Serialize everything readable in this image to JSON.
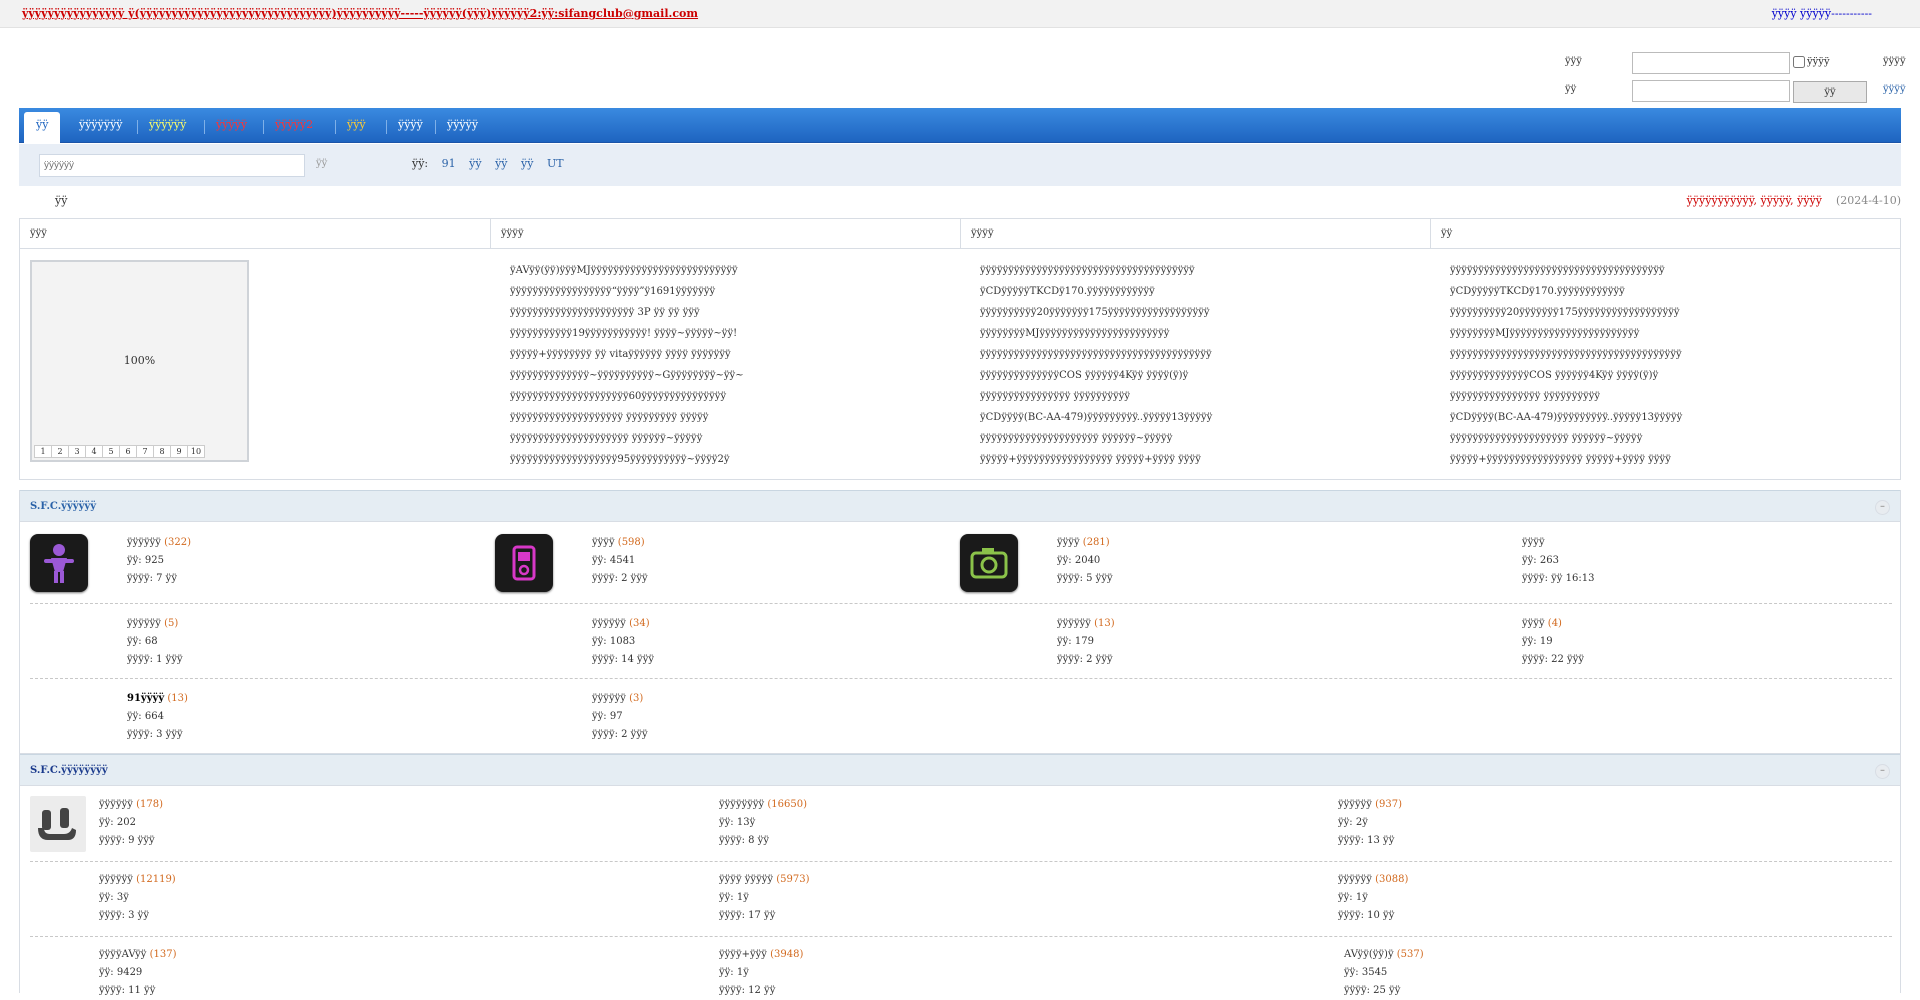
{
  "topbar": {
    "notice": "ÿÿÿÿÿÿÿÿÿÿÿÿÿÿÿÿ ÿ(ÿÿÿÿÿÿÿÿÿÿÿÿÿÿÿÿÿÿÿÿÿÿÿÿÿÿÿÿÿÿ)ÿÿÿÿÿÿÿÿÿÿ-----ÿÿÿÿÿÿ(ÿÿÿ)ÿÿÿÿÿÿ2:ÿÿ:sifangclub@gmail.com",
    "right_links": "ÿÿÿÿ ÿÿÿÿÿ-----------"
  },
  "login": {
    "user_label": "ÿÿÿ",
    "pass_label": "ÿÿ",
    "remember_label": "ÿÿÿÿ",
    "login_button": "ÿÿ",
    "side_top": "ÿÿÿÿ",
    "side_bottom": "ÿÿÿÿ"
  },
  "nav": {
    "tabs": [
      {
        "label": "ÿÿ",
        "color": "#1e64c0"
      },
      {
        "label": "ÿÿÿÿÿÿÿ",
        "color": "#ffffff"
      },
      {
        "label": "ÿÿÿÿÿÿ",
        "color": "#ffff66"
      },
      {
        "label": "ÿÿÿÿÿ",
        "color": "#ff3333"
      },
      {
        "label": "ÿÿÿÿÿ2",
        "color": "#ff3333"
      },
      {
        "label": "ÿÿÿ",
        "color": "#ffcc33"
      },
      {
        "label": "ÿÿÿÿ",
        "color": "#ffffff"
      },
      {
        "label": "ÿÿÿÿÿ",
        "color": "#ffffff"
      }
    ]
  },
  "search": {
    "placeholder": "ÿÿÿÿÿÿ",
    "button": "ÿÿ",
    "hot_label": "ÿÿ:",
    "keywords": [
      "91",
      "ÿÿ",
      "ÿÿ",
      "ÿÿ",
      "UT"
    ]
  },
  "info": {
    "left": "ÿÿ",
    "right_red": "ÿÿÿÿÿÿÿÿÿÿÿ, ÿÿÿÿÿ, ÿÿÿÿ",
    "date": "(2024-4-10)"
  },
  "portal": {
    "headers": [
      "ÿÿÿ",
      "ÿÿÿÿ",
      "ÿÿÿÿ",
      "ÿÿ"
    ],
    "slide_percent": "100%",
    "slide_numbers": [
      "1",
      "2",
      "3",
      "4",
      "5",
      "6",
      "7",
      "8",
      "9",
      "10"
    ],
    "col2": [
      "ÿAVÿÿ(ÿÿ)ÿÿÿMJÿÿÿÿÿÿÿÿÿÿÿÿÿÿÿÿÿÿÿÿÿÿÿÿÿÿ",
      "ÿÿÿÿÿÿÿÿÿÿÿÿÿÿÿÿÿÿ“ÿÿÿÿ”ÿ1691ÿÿÿÿÿÿÿ",
      "ÿÿÿÿÿÿÿÿÿÿÿÿÿÿÿÿÿÿÿÿÿÿ 3P ÿÿ ÿÿ ÿÿÿ",
      "ÿÿÿÿÿÿÿÿÿÿÿ19ÿÿÿÿÿÿÿÿÿÿÿ! ÿÿÿÿ~ÿÿÿÿÿ~ÿÿ!",
      "ÿÿÿÿÿ+ÿÿÿÿÿÿÿÿ ÿÿ vitaÿÿÿÿÿÿ ÿÿÿÿ ÿÿÿÿÿÿÿ",
      "ÿÿÿÿÿÿÿÿÿÿÿÿÿÿ~ÿÿÿÿÿÿÿÿÿÿ~Gÿÿÿÿÿÿÿÿ~ÿÿ~",
      "ÿÿÿÿÿÿÿÿÿÿÿÿÿÿÿÿÿÿÿÿÿ60ÿÿÿÿÿÿÿÿÿÿÿÿÿÿÿ",
      "ÿÿÿÿÿÿÿÿÿÿÿÿÿÿÿÿÿÿÿÿ ÿÿÿÿÿÿÿÿÿ ÿÿÿÿÿ",
      "ÿÿÿÿÿÿÿÿÿÿÿÿÿÿÿÿÿÿÿÿÿ ÿÿÿÿÿÿ~ÿÿÿÿÿ",
      "ÿÿÿÿÿÿÿÿÿÿÿÿÿÿÿÿÿÿÿ95ÿÿÿÿÿÿÿÿÿÿ~ÿÿÿÿ2ÿ"
    ],
    "col3": [
      "ÿÿÿÿÿÿÿÿÿÿÿÿÿÿÿÿÿÿÿÿÿÿÿÿÿÿÿÿÿÿÿÿÿÿÿÿÿÿ",
      "ÿCDÿÿÿÿÿTKCDÿ170.ÿÿÿÿÿÿÿÿÿÿÿÿ",
      "ÿÿÿÿÿÿÿÿÿÿ20ÿÿÿÿÿÿÿ175ÿÿÿÿÿÿÿÿÿÿÿÿÿÿÿÿÿÿ",
      "ÿÿÿÿÿÿÿÿMJÿÿÿÿÿÿÿÿÿÿÿÿÿÿÿÿÿÿÿÿÿÿÿ",
      "ÿÿÿÿÿÿÿÿÿÿÿÿÿÿÿÿÿÿÿÿÿÿÿÿÿÿÿÿÿÿÿÿÿÿÿÿÿÿÿÿÿ",
      "ÿÿÿÿÿÿÿÿÿÿÿÿÿÿCOS ÿÿÿÿÿÿ4Kÿÿ ÿÿÿÿ(ÿ)ÿ",
      "ÿÿÿÿÿÿÿÿÿÿÿÿÿÿÿÿ ÿÿÿÿÿÿÿÿÿÿ",
      "ÿCDÿÿÿÿ(BC-AA-479)ÿÿÿÿÿÿÿÿÿ..ÿÿÿÿÿ13ÿÿÿÿÿ",
      "ÿÿÿÿÿÿÿÿÿÿÿÿÿÿÿÿÿÿÿÿÿ ÿÿÿÿÿÿ~ÿÿÿÿÿ",
      "ÿÿÿÿÿ+ÿÿÿÿÿÿÿÿÿÿÿÿÿÿÿÿÿ ÿÿÿÿÿ+ÿÿÿÿ ÿÿÿÿ"
    ],
    "col4": [
      "ÿÿÿÿÿÿÿÿÿÿÿÿÿÿÿÿÿÿÿÿÿÿÿÿÿÿÿÿÿÿÿÿÿÿÿÿÿÿ",
      "ÿCDÿÿÿÿÿTKCDÿ170.ÿÿÿÿÿÿÿÿÿÿÿÿ",
      "ÿÿÿÿÿÿÿÿÿÿ20ÿÿÿÿÿÿÿ175ÿÿÿÿÿÿÿÿÿÿÿÿÿÿÿÿÿÿ",
      "ÿÿÿÿÿÿÿÿMJÿÿÿÿÿÿÿÿÿÿÿÿÿÿÿÿÿÿÿÿÿÿÿ",
      "ÿÿÿÿÿÿÿÿÿÿÿÿÿÿÿÿÿÿÿÿÿÿÿÿÿÿÿÿÿÿÿÿÿÿÿÿÿÿÿÿÿ",
      "ÿÿÿÿÿÿÿÿÿÿÿÿÿÿCOS ÿÿÿÿÿÿ4Kÿÿ ÿÿÿÿ(ÿ)ÿ",
      "ÿÿÿÿÿÿÿÿÿÿÿÿÿÿÿÿ ÿÿÿÿÿÿÿÿÿÿ",
      "ÿCDÿÿÿÿ(BC-AA-479)ÿÿÿÿÿÿÿÿÿ..ÿÿÿÿÿ13ÿÿÿÿÿ",
      "ÿÿÿÿÿÿÿÿÿÿÿÿÿÿÿÿÿÿÿÿÿ ÿÿÿÿÿÿ~ÿÿÿÿÿ",
      "ÿÿÿÿÿ+ÿÿÿÿÿÿÿÿÿÿÿÿÿÿÿÿÿ ÿÿÿÿÿ+ÿÿÿÿ ÿÿÿÿ"
    ]
  },
  "section1": {
    "title": "S.F.C.ÿÿÿÿÿÿ",
    "collapse": "–",
    "forums": [
      {
        "name": "ÿÿÿÿÿÿ",
        "count": "(322)",
        "topics": "ÿÿ: 925",
        "last": "ÿÿÿÿ: 7 ÿÿ",
        "icon": "doll-icon",
        "icon_color": "#9b59d6"
      },
      {
        "name": "ÿÿÿÿ",
        "count": "(598)",
        "topics": "ÿÿ: 4541",
        "last": "ÿÿÿÿ: 2 ÿÿÿ",
        "icon": "music-player-icon",
        "icon_color": "#d838c8"
      },
      {
        "name": "ÿÿÿÿ",
        "count": "(281)",
        "topics": "ÿÿ: 2040",
        "last": "ÿÿÿÿ: 5 ÿÿÿ",
        "icon": "camera-icon",
        "icon_color": "#8bc34a"
      },
      {
        "name": "ÿÿÿÿ",
        "count": "",
        "topics": "ÿÿ: 263",
        "last": "ÿÿÿÿ: ÿÿ 16:13"
      },
      {
        "name": "ÿÿÿÿÿÿ",
        "count": "(5)",
        "topics": "ÿÿ: 68",
        "last": "ÿÿÿÿ: 1 ÿÿÿ"
      },
      {
        "name": "ÿÿÿÿÿÿ",
        "count": "(34)",
        "topics": "ÿÿ: 1083",
        "last": "ÿÿÿÿ: 14 ÿÿÿ"
      },
      {
        "name": "ÿÿÿÿÿÿ",
        "count": "(13)",
        "topics": "ÿÿ: 179",
        "last": "ÿÿÿÿ: 2 ÿÿÿ"
      },
      {
        "name": "ÿÿÿÿ",
        "count": "(4)",
        "topics": "ÿÿ: 19",
        "last": "ÿÿÿÿ: 22 ÿÿÿ"
      },
      {
        "name": "91ÿÿÿÿ",
        "count": "(13)",
        "topics": "ÿÿ: 664",
        "last": "ÿÿÿÿ: 3 ÿÿÿ"
      },
      {
        "name": "ÿÿÿÿÿÿ",
        "count": "(3)",
        "topics": "ÿÿ: 97",
        "last": "ÿÿÿÿ: 2 ÿÿÿ"
      }
    ]
  },
  "section2": {
    "title": "S.F.C.ÿÿÿÿÿÿÿÿ",
    "collapse": "–",
    "forums": [
      {
        "name": "ÿÿÿÿÿÿ",
        "count": "(178)",
        "topics": "ÿÿ: 202",
        "last": "ÿÿÿÿ: 9 ÿÿÿ",
        "icon": "forum-logo-icon"
      },
      {
        "name": "ÿÿÿÿÿÿÿÿ",
        "count": "(16650)",
        "topics": "ÿÿ: 13ÿ",
        "last": "ÿÿÿÿ: 8 ÿÿ"
      },
      {
        "name": "ÿÿÿÿÿÿ",
        "count": "(937)",
        "topics": "ÿÿ: 2ÿ",
        "last": "ÿÿÿÿ: 13 ÿÿ"
      },
      {
        "name": "ÿÿÿÿÿÿ",
        "count": "(12119)",
        "topics": "ÿÿ: 3ÿ",
        "last": "ÿÿÿÿ: 3 ÿÿ"
      },
      {
        "name": "ÿÿÿÿ ÿÿÿÿÿ",
        "count": "(5973)",
        "topics": "ÿÿ: 1ÿ",
        "last": "ÿÿÿÿ: 17 ÿÿ"
      },
      {
        "name": "ÿÿÿÿÿÿ",
        "count": "(3088)",
        "topics": "ÿÿ: 1ÿ",
        "last": "ÿÿÿÿ: 10 ÿÿ"
      },
      {
        "name": "ÿÿÿÿAVÿÿ",
        "count": "(137)",
        "topics": "ÿÿ: 9429",
        "last": "ÿÿÿÿ: 11 ÿÿ"
      },
      {
        "name": "ÿÿÿÿ+ÿÿÿ",
        "count": "(3948)",
        "topics": "ÿÿ: 1ÿ",
        "last": "ÿÿÿÿ: 12 ÿÿ"
      },
      {
        "name": "AVÿÿ(ÿÿ)ÿ",
        "count": "(537)",
        "topics": "ÿÿ: 3545",
        "last": "ÿÿÿÿ: 25 ÿÿ"
      }
    ]
  }
}
